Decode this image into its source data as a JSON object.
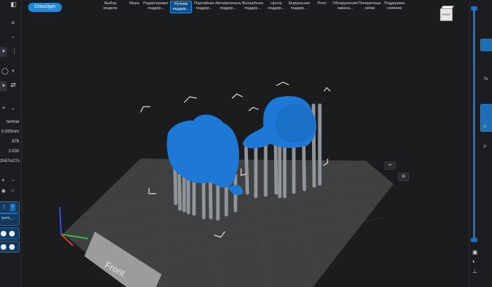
{
  "app": {
    "logo_label": "ChituGlyph"
  },
  "toolbar": {
    "items": [
      {
        "label": "Выбор модели"
      },
      {
        "label": "Мера"
      },
      {
        "label": "Редактировать поддер..."
      },
      {
        "label": "Ручная поддер..."
      },
      {
        "label": "Партийная поддер..."
      },
      {
        "label": "Автоматическа поддер..."
      },
      {
        "label": "Волшебная поддер..."
      },
      {
        "label": "Центр поддер..."
      },
      {
        "label": "Зеркальная поддер..."
      },
      {
        "label": "Плот"
      },
      {
        "label": "Обнаружение нависа..."
      },
      {
        "label": "Поперечные связи"
      },
      {
        "label": "Поддержка слияние"
      }
    ],
    "active_index": 3
  },
  "left_panel": {
    "mode_value": "normal",
    "layer_height": "0.050mm",
    "layer_count": "876",
    "value_3": "3.000",
    "print_time": "2h57m27s",
    "object_name": "lparts_..."
  },
  "right_panel": {
    "label_t": "Te",
    "label_a": "A",
    "label_p": "P"
  },
  "viewport": {
    "plate_label": "Front",
    "viewcube_label": "FRONT"
  },
  "colors": {
    "accent": "#1f8bd8",
    "model": "#1d78d6",
    "support": "#8f959b",
    "plate": "#3f4042"
  }
}
